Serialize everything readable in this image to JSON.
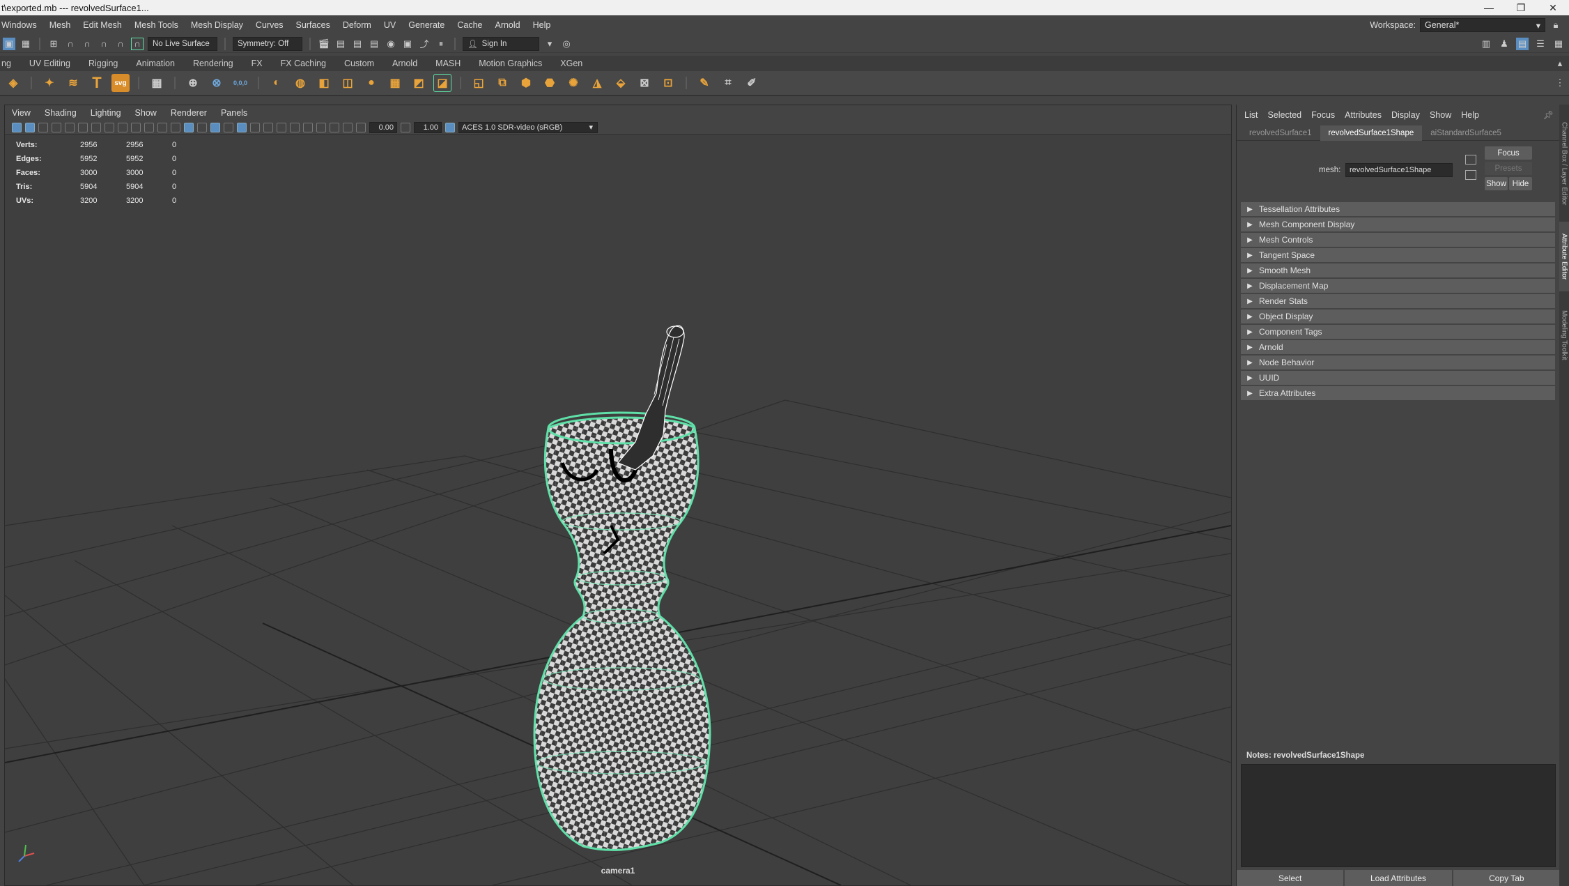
{
  "window": {
    "title": "t\\exported.mb  ---  revolvedSurface1...",
    "controls": [
      "—",
      "❐",
      "✕"
    ]
  },
  "menubar": {
    "items": [
      "Windows",
      "Mesh",
      "Edit Mesh",
      "Mesh Tools",
      "Mesh Display",
      "Curves",
      "Surfaces",
      "Deform",
      "UV",
      "Generate",
      "Cache",
      "Arnold",
      "Help"
    ],
    "workspace_label": "Workspace:",
    "workspace_value": "General*"
  },
  "statusline": {
    "live_surface": "No Live Surface",
    "symmetry": "Symmetry: Off",
    "sign_in": "Sign In"
  },
  "shelf": {
    "tabs": [
      "ng",
      "UV Editing",
      "Rigging",
      "Animation",
      "Rendering",
      "FX",
      "FX Caching",
      "Custom",
      "Arnold",
      "MASH",
      "Motion Graphics",
      "XGen"
    ],
    "icon_labels": {
      "text_tool": "T",
      "svg_tool": "svg",
      "coord": "0,0,0"
    }
  },
  "viewport": {
    "menus": [
      "View",
      "Shading",
      "Lighting",
      "Show",
      "Renderer",
      "Panels"
    ],
    "exposure": "0.00",
    "gamma": "1.00",
    "color_space": "ACES 1.0 SDR-video (sRGB)",
    "hud": [
      {
        "label": "Verts:",
        "a": "2956",
        "b": "2956",
        "c": "0"
      },
      {
        "label": "Edges:",
        "a": "5952",
        "b": "5952",
        "c": "0"
      },
      {
        "label": "Faces:",
        "a": "3000",
        "b": "3000",
        "c": "0"
      },
      {
        "label": "Tris:",
        "a": "5904",
        "b": "5904",
        "c": "0"
      },
      {
        "label": "UVs:",
        "a": "3200",
        "b": "3200",
        "c": "0"
      }
    ],
    "camera": "camera1"
  },
  "attribute_editor": {
    "menus": [
      "List",
      "Selected",
      "Focus",
      "Attributes",
      "Display",
      "Show",
      "Help"
    ],
    "tabs": [
      "revolvedSurface1",
      "revolvedSurface1Shape",
      "aiStandardSurface5"
    ],
    "active_tab": 1,
    "mesh_label": "mesh:",
    "mesh_value": "revolvedSurface1Shape",
    "buttons": {
      "focus": "Focus",
      "presets": "Presets",
      "show": "Show",
      "hide": "Hide"
    },
    "sections": [
      "Tessellation Attributes",
      "Mesh Component Display",
      "Mesh Controls",
      "Tangent Space",
      "Smooth Mesh",
      "Displacement Map",
      "Render Stats",
      "Object Display",
      "Component Tags",
      "Arnold",
      "Node Behavior",
      "UUID",
      "Extra Attributes"
    ],
    "notes_label": "Notes:",
    "notes_target": "revolvedSurface1Shape",
    "bottom_buttons": [
      "Select",
      "Load Attributes",
      "Copy Tab"
    ]
  },
  "side_tabs": [
    "Channel Box / Layer Editor",
    "Attribute Editor",
    "Modeling Toolkit"
  ],
  "colors": {
    "accent": "#5a8ec1",
    "wire_selected": "#5fe0a8",
    "shelf_orange": "#e8a33a"
  }
}
